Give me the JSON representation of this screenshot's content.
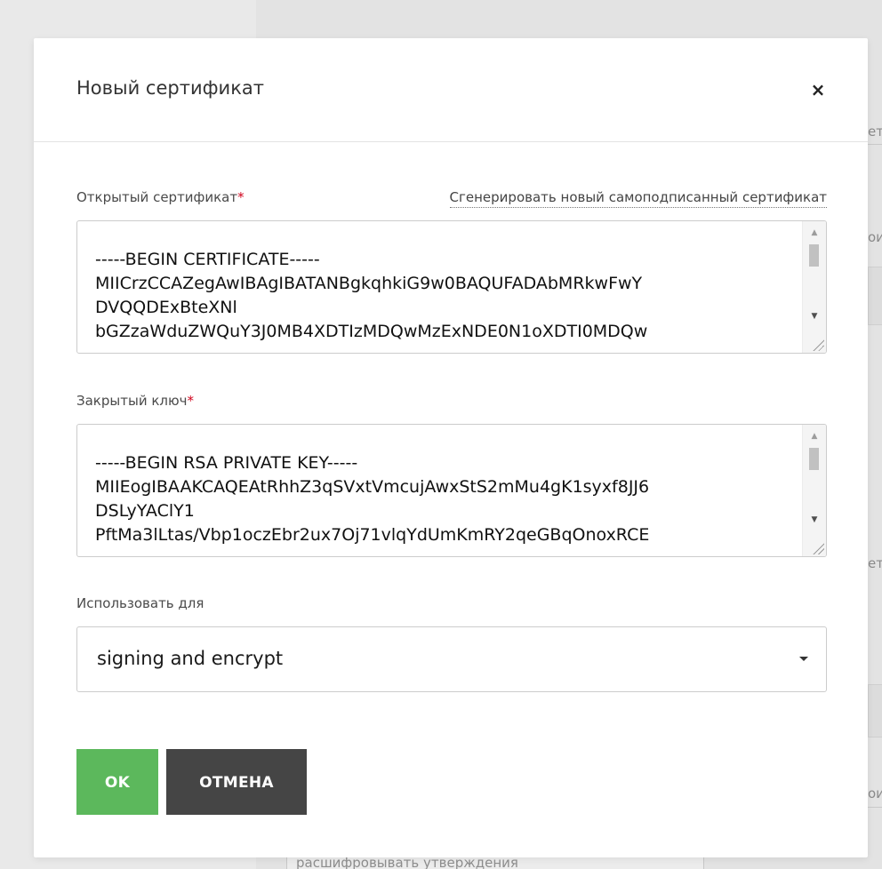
{
  "background": {
    "fragments": [
      "ет",
      "ои",
      "ет",
      "ои"
    ],
    "bottom_item": "расшифровывать утверждения"
  },
  "modal": {
    "title": "Новый сертификат",
    "close_label": "×",
    "public_cert": {
      "label": "Открытый сертификат",
      "required_mark": "*",
      "generate_link": "Сгенерировать новый самоподписанный сертификат",
      "value": "-----BEGIN CERTIFICATE-----\nMIICrzCCAZegAwIBAgIBATANBgkqhkiG9w0BAQUFADAbMRkwFwY\nDVQQDExBteXNl\nbGZzaWduZWQuY3J0MB4XDTIzMDQwMzExNDE0N1oXDTI0MDQw"
    },
    "private_key": {
      "label": "Закрытый ключ",
      "required_mark": "*",
      "value": "-----BEGIN RSA PRIVATE KEY-----\nMIIEogIBAAKCAQEAtRhhZ3qSVxtVmcujAwxStS2mMu4gK1syxf8JJ6\nDSLyYAClY1\nPftMa3lLtas/Vbp1oczEbr2ux7Oj71vlqYdUmKmRY2qeGBqOnoxRCE"
    },
    "use_for": {
      "label": "Использовать для",
      "selected": "signing and encrypt"
    },
    "buttons": {
      "ok": "OK",
      "cancel": "ОТМЕНА"
    }
  },
  "colors": {
    "ok_button": "#5cb85c",
    "cancel_button": "#454545",
    "required": "#d0021b"
  }
}
